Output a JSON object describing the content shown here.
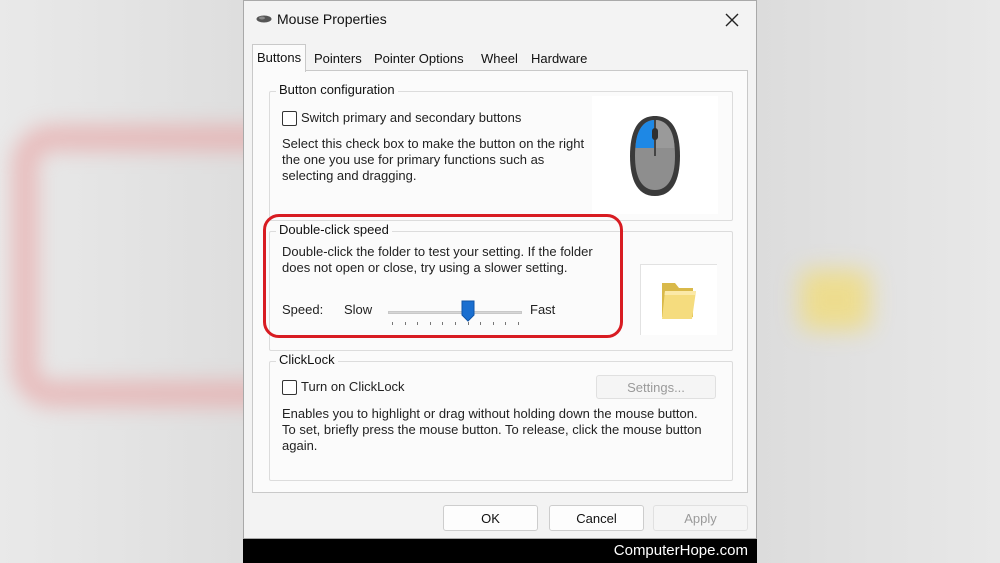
{
  "window": {
    "title": "Mouse Properties"
  },
  "tabs": [
    {
      "label": "Buttons",
      "active": true
    },
    {
      "label": "Pointers"
    },
    {
      "label": "Pointer Options"
    },
    {
      "label": "Wheel"
    },
    {
      "label": "Hardware"
    }
  ],
  "button_config": {
    "legend": "Button configuration",
    "checkbox_label": "Switch primary and secondary buttons",
    "checked": false,
    "desc": [
      "Select this check box to make the button on the right",
      "the one you use for primary functions such as",
      "selecting and dragging."
    ]
  },
  "double_click": {
    "legend": "Double-click speed",
    "desc": [
      "Double-click the folder to test your setting. If the folder",
      "does not open or close, try using a slower setting."
    ],
    "speed_label": "Speed:",
    "slow_label": "Slow",
    "fast_label": "Fast",
    "slider_value": 0.6
  },
  "clicklock": {
    "legend": "ClickLock",
    "checkbox_label": "Turn on ClickLock",
    "checked": false,
    "settings_label": "Settings...",
    "desc": [
      "Enables you to highlight or drag without holding down the mouse button.",
      "To set, briefly press the mouse button. To release, click the mouse button",
      "again."
    ]
  },
  "footer": {
    "ok": "OK",
    "cancel": "Cancel",
    "apply": "Apply"
  },
  "watermark": "ComputerHope.com",
  "colors": {
    "highlight": "#d81c22",
    "slider_thumb": "#1a6fd0",
    "mouse_button": "#1e88e5"
  }
}
